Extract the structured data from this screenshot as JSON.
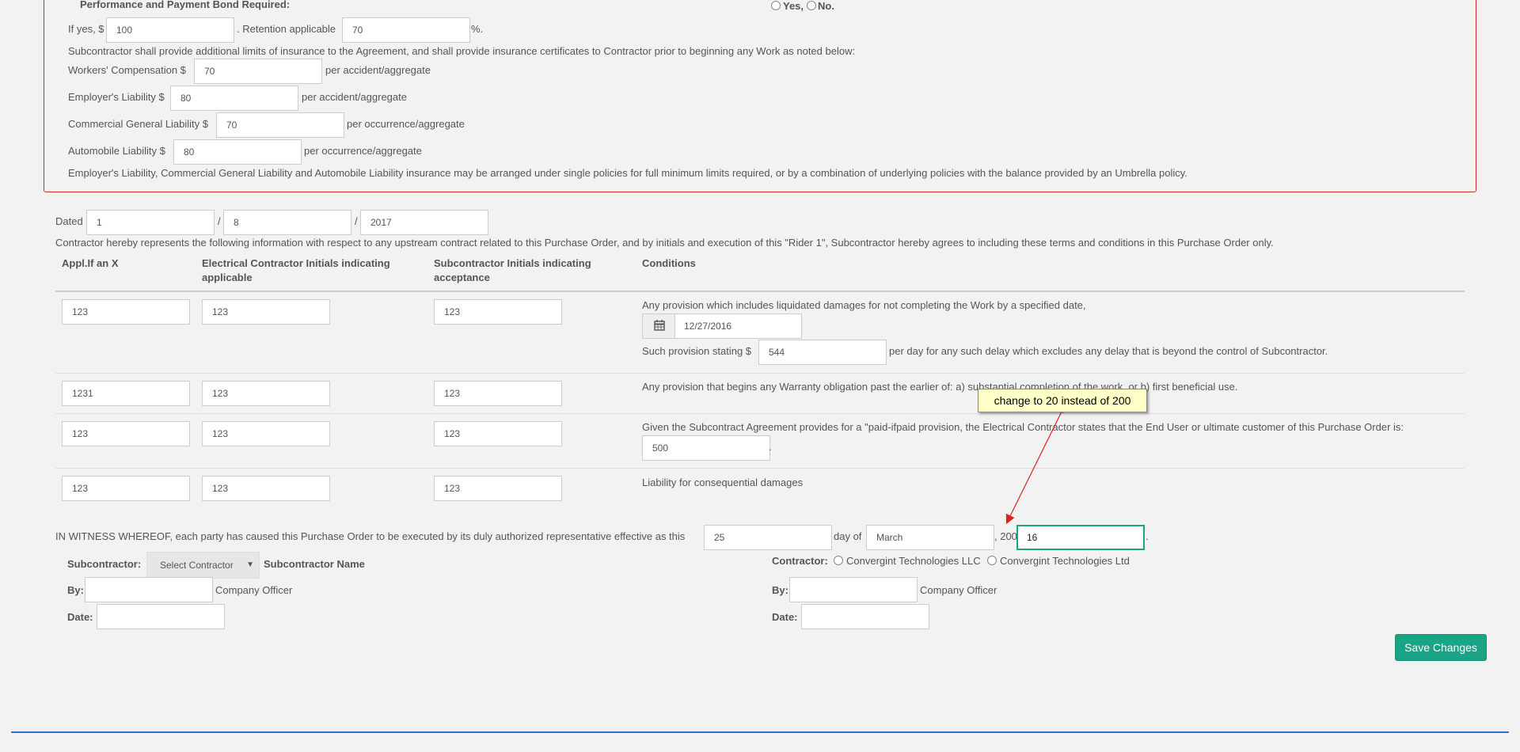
{
  "bond": {
    "title": "Performance and Payment Bond Required:",
    "yes_label": "Yes,",
    "no_label": "No.",
    "if_yes_label": "If yes, $",
    "amount": "100",
    "retention_label": ". Retention applicable",
    "retention": "70",
    "percent_suffix": "%."
  },
  "insurance": {
    "intro": "Subcontractor shall provide additional limits of insurance to the Agreement, and shall provide insurance certificates to Contractor prior to beginning any Work as noted below:",
    "workers_label": "Workers' Compensation $",
    "workers_value": "70",
    "workers_suffix": "per accident/aggregate",
    "employers_label": "Employer's Liability $",
    "employers_value": "80",
    "employers_suffix": "per accident/aggregate",
    "cgl_label": "Commercial General Liability $",
    "cgl_value": "70",
    "cgl_suffix": "per occurrence/aggregate",
    "auto_label": "Automobile Liability $",
    "auto_value": "80",
    "auto_suffix": "per occurrence/aggregate",
    "note": "Employer's Liability, Commercial General Liability and Automobile Liability insurance may be arranged under single policies for full minimum limits required, or by a combination of underlying policies with the balance provided by an Umbrella policy."
  },
  "dated": {
    "label": "Dated",
    "day": "1",
    "month": "8",
    "year": "2017",
    "sep": "/"
  },
  "rider_text": "Contractor hereby represents the following information with respect to any upstream contract related to this Purchase Order, and by initials and execution of this \"Rider 1\", Subcontractor hereby agrees to including these terms and conditions in this Purchase Order only.",
  "table": {
    "headers": {
      "appl": "Appl.If an X",
      "elec_line1": "Electrical Contractor Initials indicating",
      "elec_line2": "applicable",
      "sub_line1": "Subcontractor Initials indicating",
      "sub_line2": "acceptance",
      "conditions": "Conditions"
    },
    "rows": [
      {
        "appl": "123",
        "elec": "123",
        "sub": "123",
        "condition": "Any provision which includes liquidated damages for not completing the Work by a specified date,"
      },
      {
        "appl": "1231",
        "elec": "123",
        "sub": "123",
        "condition": "Any provision that begins any Warranty obligation past the earlier of: a) substantial completion of the work, or b) first beneficial use."
      },
      {
        "appl": "123",
        "elec": "123",
        "sub": "123",
        "condition": "Given the Subcontract Agreement provides for a \"paid-ifpaid provision, the Electrical Contractor states that the End User or ultimate customer of this Purchase Order is:"
      },
      {
        "appl": "123",
        "elec": "123",
        "sub": "123",
        "condition": "Liability for consequential damages"
      }
    ],
    "row1_date": "12/27/2016",
    "provision_label": "Such provision stating $",
    "provision_value": "544",
    "provision_suffix": "per day for any such delay which excludes any delay that is beyond the control of Subcontractor.",
    "end_user_value": "500",
    "end_user_suffix": "."
  },
  "witness": {
    "text": "IN WITNESS WHEREOF, each party has caused this Purchase Order to be executed by its duly authorized representative effective as this",
    "day": "25",
    "day_of": "day of",
    "month": "March",
    "year_prefix": ", 200",
    "year": "16",
    "suffix": "."
  },
  "subcontractor": {
    "label": "Subcontractor:",
    "select_value": "Select Contractor",
    "name_label": "Subcontractor Name",
    "by_label": "By:",
    "officer": "Company Officer",
    "date_label": "Date:"
  },
  "contractor": {
    "label": "Contractor:",
    "option1": "Convergint Technologies LLC",
    "option2": "Convergint Technologies Ltd",
    "by_label": "By:",
    "officer": "Company Officer",
    "date_label": "Date:"
  },
  "tooltip": "change to 20 instead of 200",
  "save_button": "Save Changes",
  "colors": {
    "accent": "#1aa385",
    "error_border": "#c9302c",
    "annotation_arrow": "#e02020",
    "bottom_rule": "#2e6fd8"
  }
}
